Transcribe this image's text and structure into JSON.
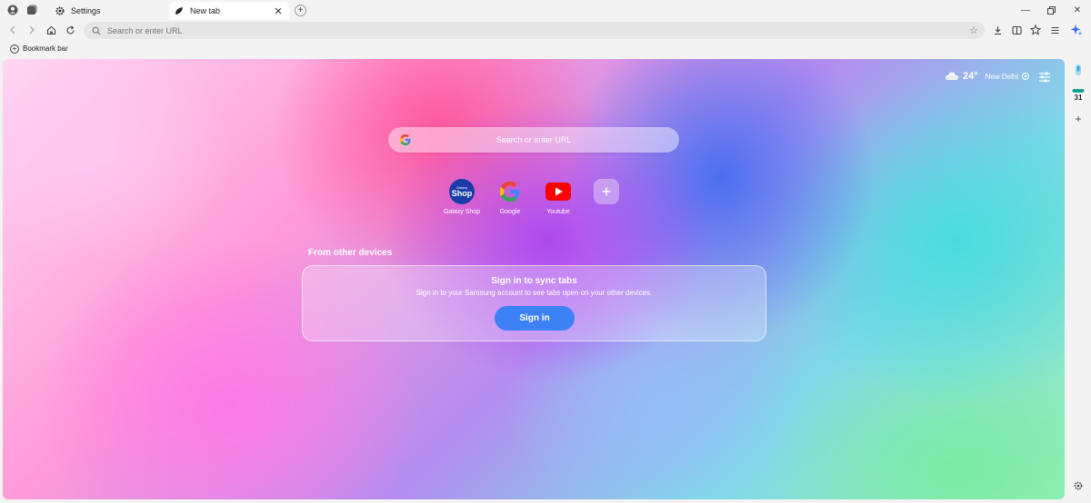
{
  "tabs": [
    {
      "label": "Settings"
    },
    {
      "label": "New tab"
    }
  ],
  "toolbar": {
    "url_placeholder": "Search or enter URL"
  },
  "bookmark_bar": {
    "label": "Bookmark bar"
  },
  "newtab": {
    "weather": {
      "temp": "24°",
      "city": "New Delhi"
    },
    "search_placeholder": "Search or enter URL",
    "shortcuts": [
      {
        "label": "Galaxy Shop",
        "icon": "galaxy-shop-icon",
        "tile_small": "Galaxy",
        "tile_big": "Shop"
      },
      {
        "label": "Google",
        "icon": "google-icon"
      },
      {
        "label": "Youtube",
        "icon": "youtube-icon"
      }
    ],
    "add_shortcut": "+",
    "devices_heading": "From other devices",
    "sync_title": "Sign in to sync tabs",
    "sync_body": "Sign in to your Samsung account to see tabs open on your other devices.",
    "signin_label": "Sign in"
  },
  "sidepanel": {
    "calendar_day": "31"
  },
  "colors": {
    "signin_button": "#3d82f5",
    "galaxy_tile": "#1b3ca8",
    "youtube_red": "#ff0000"
  }
}
